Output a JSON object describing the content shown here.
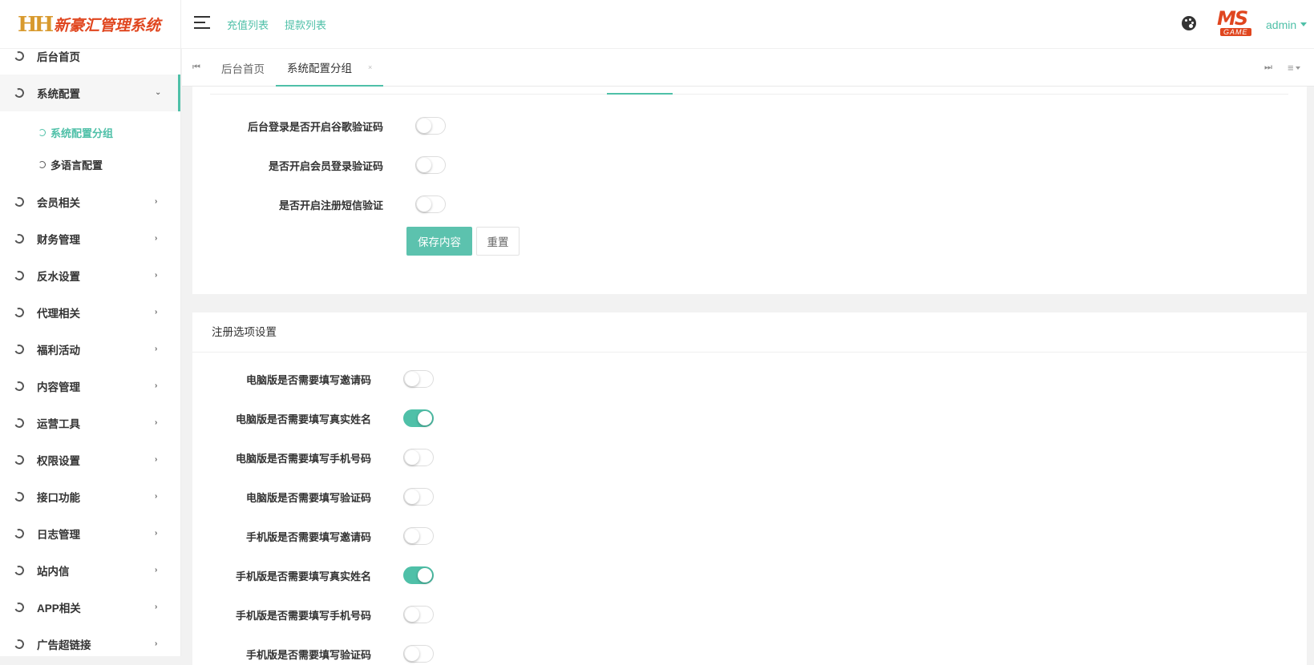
{
  "header": {
    "logo_mark": "HH",
    "logo_text": "新豪汇管理系统",
    "top_links": [
      "充值列表",
      "提款列表"
    ],
    "brand_ms": "MS",
    "brand_game": "GAME",
    "user": "admin"
  },
  "sidebar": {
    "items": [
      {
        "label": "后台首页"
      },
      {
        "label": "系统配置"
      },
      {
        "label": "会员相关"
      },
      {
        "label": "财务管理"
      },
      {
        "label": "反水设置"
      },
      {
        "label": "代理相关"
      },
      {
        "label": "福利活动"
      },
      {
        "label": "内容管理"
      },
      {
        "label": "运营工具"
      },
      {
        "label": "权限设置"
      },
      {
        "label": "接口功能"
      },
      {
        "label": "日志管理"
      },
      {
        "label": "站内信"
      },
      {
        "label": "APP相关"
      },
      {
        "label": "广告超链接"
      }
    ],
    "sub_items": [
      {
        "label": "系统配置分组",
        "active": true
      },
      {
        "label": "多语言配置",
        "active": false
      }
    ]
  },
  "tabs": {
    "items": [
      {
        "label": "后台首页"
      },
      {
        "label": "系统配置分组",
        "close": "×"
      }
    ],
    "menu_icon": "≡"
  },
  "card1": {
    "rows": [
      {
        "label": "后台登录是否开启谷歌验证码",
        "on": false
      },
      {
        "label": "是否开启会员登录验证码",
        "on": false
      },
      {
        "label": "是否开启注册短信验证",
        "on": false
      }
    ],
    "save_label": "保存内容",
    "reset_label": "重置"
  },
  "card2": {
    "title": "注册选项设置",
    "rows": [
      {
        "label": "电脑版是否需要填写邀请码",
        "on": false
      },
      {
        "label": "电脑版是否需要填写真实姓名",
        "on": true
      },
      {
        "label": "电脑版是否需要填写手机号码",
        "on": false
      },
      {
        "label": "电脑版是否需要填写验证码",
        "on": false
      },
      {
        "label": "手机版是否需要填写邀请码",
        "on": false
      },
      {
        "label": "手机版是否需要填写真实姓名",
        "on": true
      },
      {
        "label": "手机版是否需要填写手机号码",
        "on": false
      },
      {
        "label": "手机版是否需要填写验证码",
        "on": false
      }
    ]
  },
  "colors": {
    "accent": "#4fc0a8",
    "logo_orange": "#e0461f",
    "logo_gold": "#d89a2e"
  }
}
